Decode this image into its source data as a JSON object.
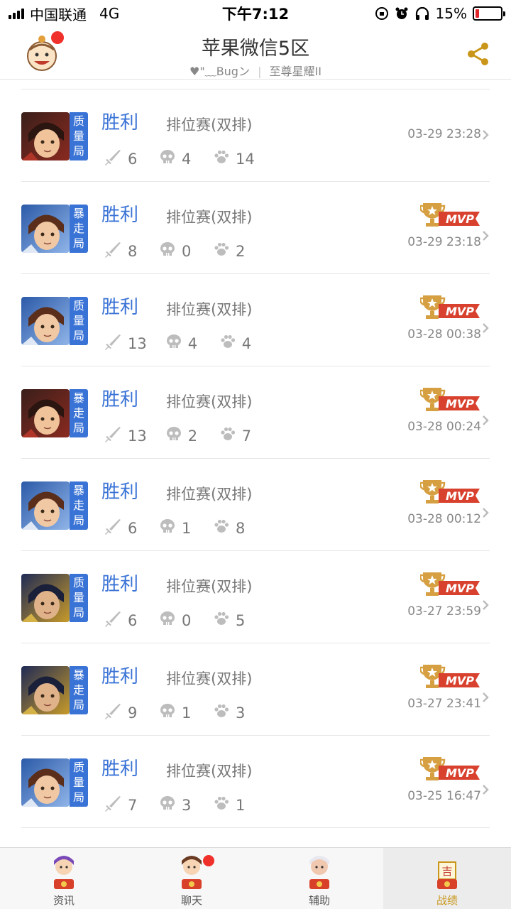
{
  "status_bar": {
    "carrier": "中国联通",
    "network": "4G",
    "time": "下午7:12",
    "battery": "15%",
    "battery_level": 0.15
  },
  "header": {
    "title": "苹果微信5区",
    "subtitle_name": "♥\"﹏Bugン",
    "subtitle_sep": "|",
    "subtitle_rank": "至尊星耀II",
    "share_icon": "share-icon",
    "accent_color": "#c9961a"
  },
  "matches": [
    {
      "hero": "hero-red",
      "tag": "质量局",
      "result": "胜利",
      "mode": "排位赛(双排)",
      "kills": "6",
      "deaths": "4",
      "assists": "14",
      "time": "03-29 23:28",
      "mvp": false
    },
    {
      "hero": "hero-blue",
      "tag": "暴走局",
      "result": "胜利",
      "mode": "排位赛(双排)",
      "kills": "8",
      "deaths": "0",
      "assists": "2",
      "time": "03-29 23:18",
      "mvp": true
    },
    {
      "hero": "hero-blue",
      "tag": "质量局",
      "result": "胜利",
      "mode": "排位赛(双排)",
      "kills": "13",
      "deaths": "4",
      "assists": "4",
      "time": "03-28 00:38",
      "mvp": true
    },
    {
      "hero": "hero-red",
      "tag": "暴走局",
      "result": "胜利",
      "mode": "排位赛(双排)",
      "kills": "13",
      "deaths": "2",
      "assists": "7",
      "time": "03-28 00:24",
      "mvp": true
    },
    {
      "hero": "hero-blue",
      "tag": "暴走局",
      "result": "胜利",
      "mode": "排位赛(双排)",
      "kills": "6",
      "deaths": "1",
      "assists": "8",
      "time": "03-28 00:12",
      "mvp": true
    },
    {
      "hero": "hero-gold",
      "tag": "质量局",
      "result": "胜利",
      "mode": "排位赛(双排)",
      "kills": "6",
      "deaths": "0",
      "assists": "5",
      "time": "03-27 23:59",
      "mvp": true
    },
    {
      "hero": "hero-gold",
      "tag": "暴走局",
      "result": "胜利",
      "mode": "排位赛(双排)",
      "kills": "9",
      "deaths": "1",
      "assists": "3",
      "time": "03-27 23:41",
      "mvp": true
    },
    {
      "hero": "hero-blue",
      "tag": "质量局",
      "result": "胜利",
      "mode": "排位赛(双排)",
      "kills": "7",
      "deaths": "3",
      "assists": "1",
      "time": "03-25 16:47",
      "mvp": true
    }
  ],
  "mvp_label": "MVP",
  "tabs": [
    {
      "label": "资讯",
      "icon": "news-mascot-icon",
      "active": false,
      "badge": false
    },
    {
      "label": "聊天",
      "icon": "chat-mascot-icon",
      "active": false,
      "badge": true
    },
    {
      "label": "辅助",
      "icon": "assist-mascot-icon",
      "active": false,
      "badge": false
    },
    {
      "label": "战绩",
      "icon": "record-mascot-icon",
      "active": true,
      "badge": false
    }
  ],
  "tab_active_glyph": "吉",
  "colors": {
    "win": "#3a73d6",
    "tag_bg": "#3a73d6",
    "mvp_red": "#d8412e",
    "mvp_gold": "#d6a042",
    "badge_red": "#f0302a"
  }
}
